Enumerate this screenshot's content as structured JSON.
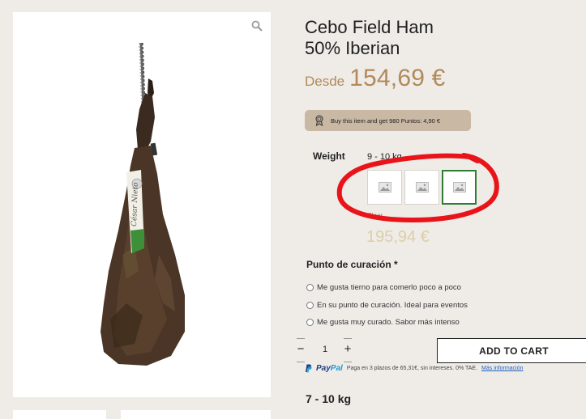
{
  "product": {
    "title_line1": "Cebo Field Ham",
    "title_line2": "50% Iberian",
    "price_prefix": "Desde",
    "price": "154,69 €"
  },
  "points_badge": "Buy this item and get 980 Puntos: 4,90 €",
  "weight": {
    "label": "Weight",
    "selected_value": "9 - 10 kg",
    "swatch_count": 3,
    "selected_index": 2,
    "clear_label": "Clear",
    "variant_price": "195,94 €"
  },
  "curing": {
    "label": "Punto de curación *",
    "options": [
      "Me gusta tierno para comerlo poco a poco",
      "En su punto de curación. Ideal para eventos",
      "Me gusta muy curado. Sabor más intenso"
    ]
  },
  "quantity": {
    "minus": "−",
    "value": "1",
    "plus": "+"
  },
  "add_to_cart_label": "ADD TO CART",
  "paypal": {
    "logo_pay": "Pay",
    "logo_pal": "Pal",
    "text": "Paga en 3 plazos de 65,31€, sin intereses. 0% TAE.",
    "link": "Más información"
  },
  "variant_title": "7 - 10 kg",
  "icons": {
    "zoom": "magnifier-icon",
    "badge": "award-ribbon-icon",
    "swatch": "image-placeholder-icon",
    "paypal": "paypal-p-icon"
  },
  "colors": {
    "price": "#b08a5a",
    "badge_bg": "#c9b8a3",
    "selected_swatch": "#2f7d32",
    "annotation": "#e8141a"
  }
}
